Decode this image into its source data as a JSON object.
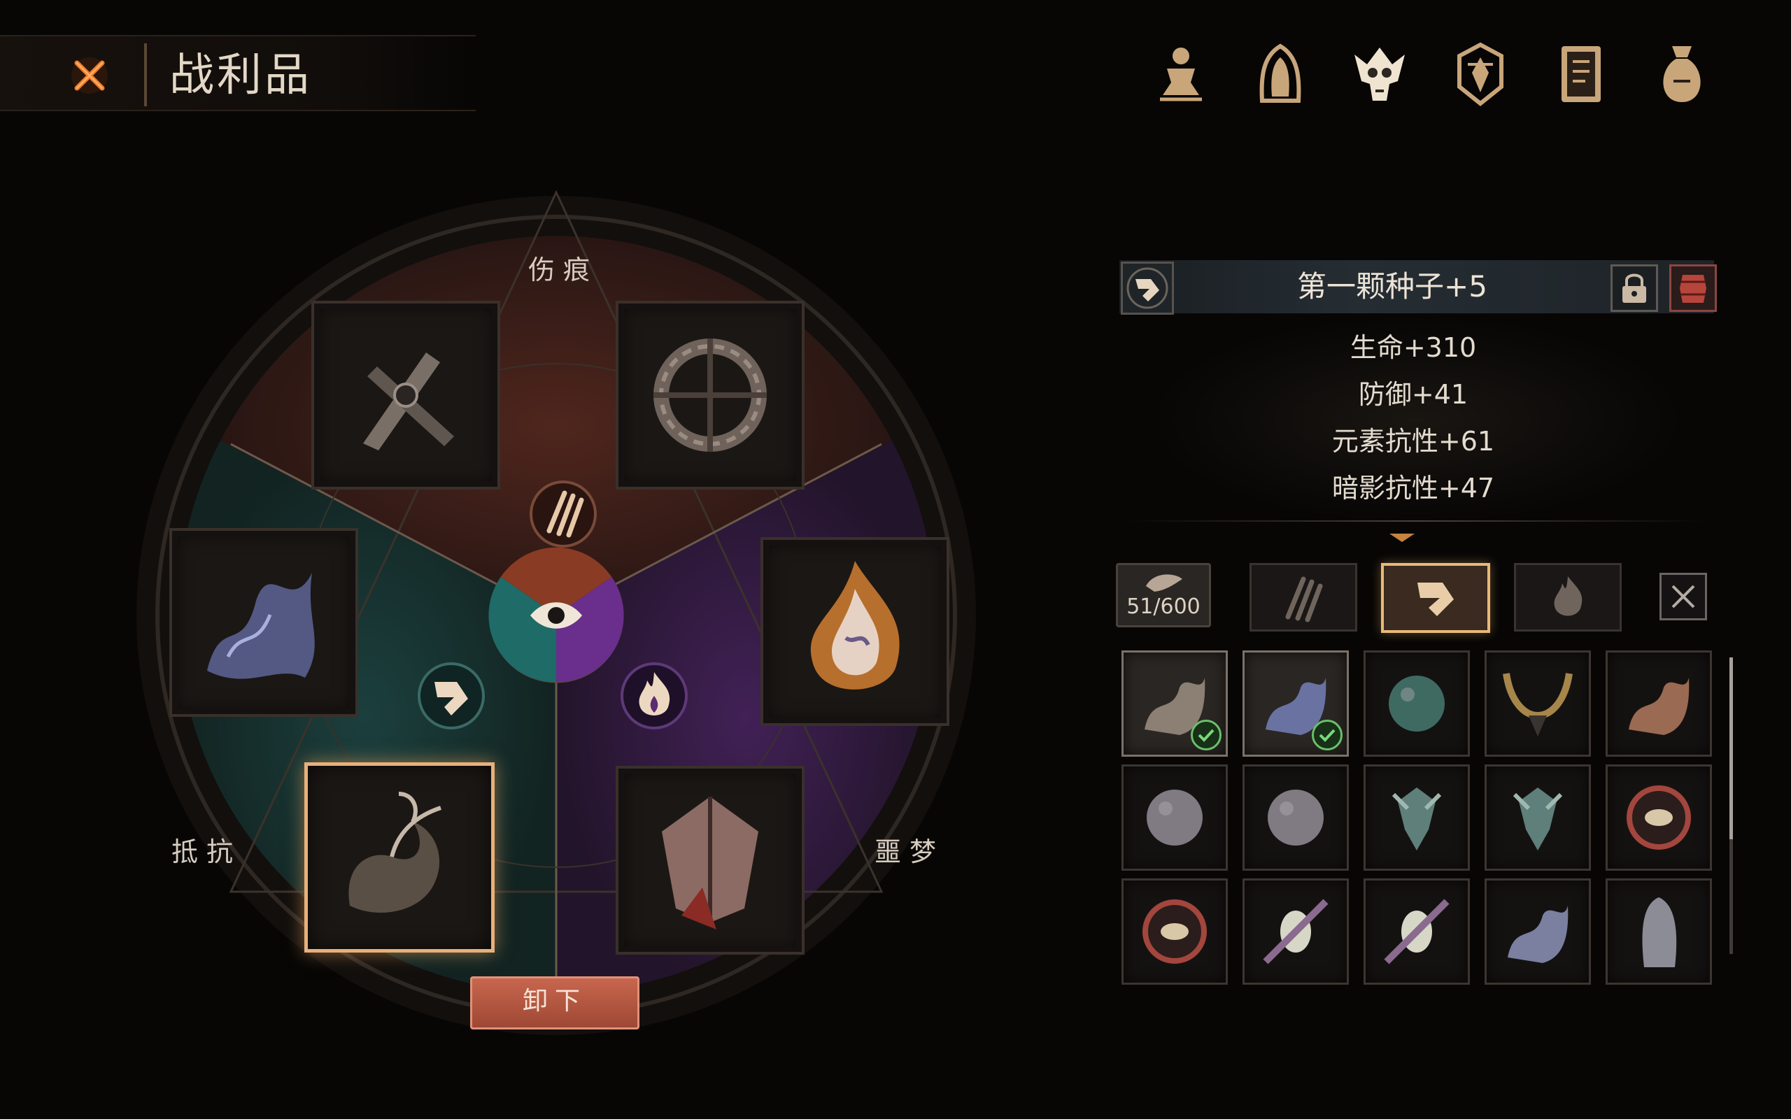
{
  "header": {
    "title": "战利品",
    "close_icon": "close-x-icon"
  },
  "nav": {
    "icons": [
      "character-icon",
      "hood-icon",
      "skull-icon",
      "shield-emblem-icon",
      "journal-icon",
      "loot-bag-icon"
    ],
    "active_index": 2,
    "accent_color": "#c9a57a"
  },
  "wheel": {
    "labels": {
      "top": "伤痕",
      "left": "抵抗",
      "right": "噩梦"
    },
    "sections": [
      {
        "name": "伤痕",
        "color": "#3d1e1a",
        "icon": "claw-slash-icon"
      },
      {
        "name": "抵抗",
        "color": "#14302f",
        "icon": "arrow-sigil-icon"
      },
      {
        "name": "噩梦",
        "color": "#2c1838",
        "icon": "flame-sigil-icon"
      }
    ],
    "center_icon": "eye-icon",
    "slots": [
      {
        "item": "scissor-blade-icon",
        "section": "伤痕"
      },
      {
        "item": "thorn-wreath-icon",
        "section": "伤痕"
      },
      {
        "item": "shadow-tendrils-icon",
        "section": "抵抗"
      },
      {
        "item": "sprout-seed-icon",
        "section": "抵抗",
        "selected": true
      },
      {
        "item": "burning-wisp-icon",
        "section": "噩梦"
      },
      {
        "item": "flayed-hide-icon",
        "section": "噩梦"
      }
    ],
    "unequip_label": "卸下"
  },
  "detail": {
    "type_icon": "arrow-sigil-icon",
    "name": "第一颗种子+5",
    "stats": [
      "生命+310",
      "防御+41",
      "元素抗性+61",
      "暗影抗性+47"
    ],
    "lock_icon": "lock-icon",
    "trash_icon": "barrel-icon"
  },
  "inventory": {
    "count": "51/600",
    "filters": [
      {
        "icon": "claw-slash-icon",
        "active": false
      },
      {
        "icon": "arrow-sigil-icon",
        "active": true
      },
      {
        "icon": "flame-sigil-icon",
        "active": false
      }
    ],
    "close_icon": "close-x-icon",
    "items": [
      {
        "icon": "sprout-seed-icon",
        "equipped": true
      },
      {
        "icon": "shadow-tendrils-icon",
        "equipped": true
      },
      {
        "icon": "moss-orb-icon",
        "equipped": false
      },
      {
        "icon": "tooth-necklace-icon",
        "equipped": false
      },
      {
        "icon": "fur-pelt-icon",
        "equipped": false
      },
      {
        "icon": "stone-orb-icon",
        "equipped": false
      },
      {
        "icon": "stone-orb-icon",
        "equipped": false
      },
      {
        "icon": "horned-bloom-icon",
        "equipped": false
      },
      {
        "icon": "horned-bloom-icon",
        "equipped": false
      },
      {
        "icon": "bound-eye-icon",
        "equipped": false
      },
      {
        "icon": "bound-eye-icon",
        "equipped": false
      },
      {
        "icon": "feather-egg-icon",
        "equipped": false
      },
      {
        "icon": "feather-egg-icon",
        "equipped": false
      },
      {
        "icon": "ash-vase-icon",
        "equipped": false
      },
      {
        "icon": "hooded-figure-icon",
        "equipped": false
      }
    ]
  }
}
